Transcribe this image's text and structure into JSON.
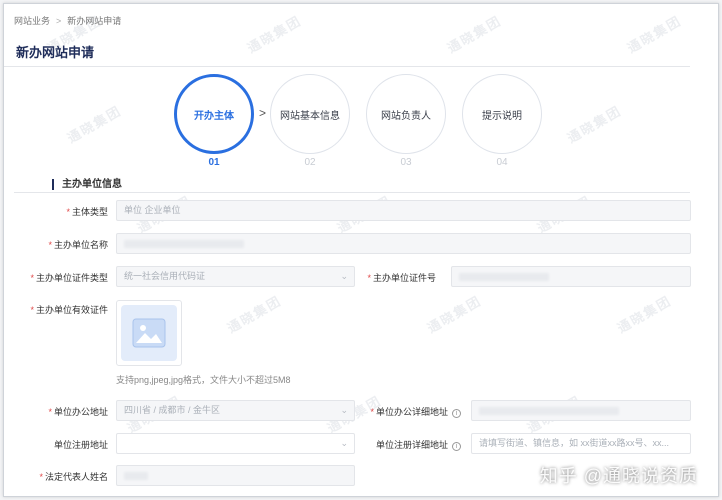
{
  "breadcrumb": {
    "root": "网站业务",
    "separator": ">",
    "current": "新办网站申请"
  },
  "page_title": "新办网站申请",
  "steps": [
    {
      "label": "开办主体",
      "num": "01",
      "active": true
    },
    {
      "label": "网站基本信息",
      "num": "02",
      "active": false
    },
    {
      "label": "网站负责人",
      "num": "03",
      "active": false
    },
    {
      "label": "提示说明",
      "num": "04",
      "active": false
    }
  ],
  "step_arrow": ">",
  "section_title": "主办单位信息",
  "required_mark": "*",
  "fields": {
    "entity_type": {
      "label": "主体类型",
      "value": "单位 企业单位"
    },
    "org_name": {
      "label": "主办单位名称",
      "value": ""
    },
    "cert_type": {
      "label": "主办单位证件类型",
      "value": "统一社会信用代码证"
    },
    "cert_no": {
      "label": "主办单位证件号",
      "value": ""
    },
    "valid_cert": {
      "label": "主办单位有效证件",
      "hint": "支持png,jpeg,jpg格式，文件大小不超过5M8"
    },
    "office_addr": {
      "label": "单位办公地址",
      "value": "四川省 / 成都市 / 金牛区"
    },
    "office_detail": {
      "label": "单位办公详细地址",
      "value": ""
    },
    "reg_addr": {
      "label": "单位注册地址",
      "value": ""
    },
    "reg_detail": {
      "label": "单位注册详细地址",
      "placeholder": "请填写街道、镇信息，如 xx街道xx路xx号、xx..."
    },
    "legal_rep": {
      "label": "法定代表人姓名",
      "value": ""
    }
  },
  "watermark_text": "通晓集团",
  "overlay_watermark": "知乎 @通晓说资质",
  "colors": {
    "accent": "#2a6fe0",
    "title": "#1f2d5a",
    "required": "#e04848"
  }
}
